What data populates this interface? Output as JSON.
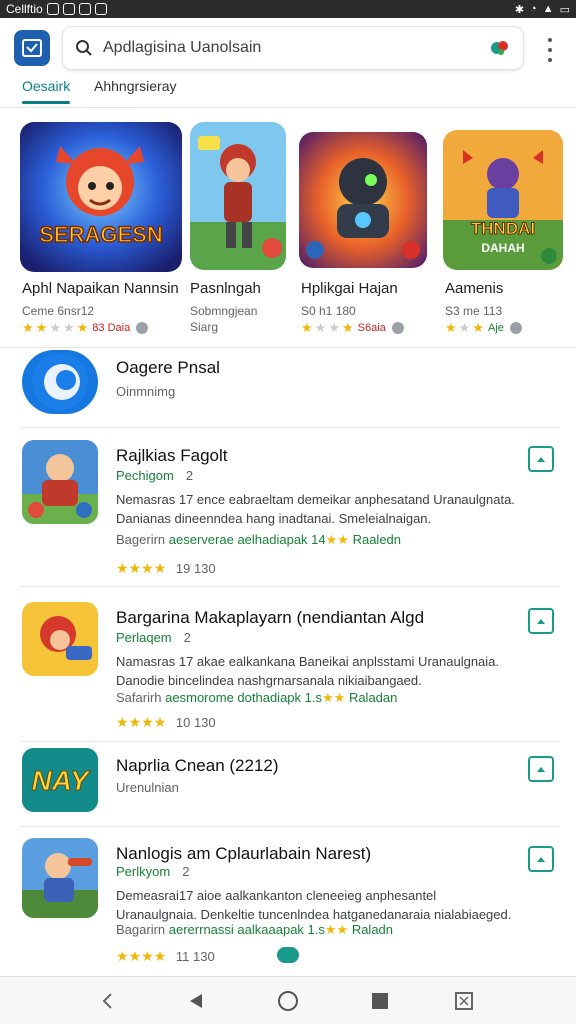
{
  "status_bar": {
    "carrier": "Cellftio"
  },
  "search": {
    "query": "Apdlagisina Uanolsain"
  },
  "tabs": [
    {
      "label": "Oesairk"
    },
    {
      "label": "Ahhngrsieray"
    }
  ],
  "featured": [
    {
      "banner": "SERAGESN",
      "name": "Aphl Napaikan Nannsin",
      "sub": "Ceme 6nsr12",
      "rating_text": "83 Daia",
      "stars": 2
    },
    {
      "name": "Pasnlngah",
      "sub": "Sobmngjean",
      "sub2": "Siarg"
    },
    {
      "name": "Hplikgai Hajan",
      "sub": "S0 h1 180",
      "rating_text": "S6aia",
      "stars": 2
    },
    {
      "banner": "THNDAI",
      "banner2": "DAHAH",
      "name": "Aamenis",
      "sub": "S3 me 113",
      "rating_text": "Aje",
      "stars": 3
    }
  ],
  "list": [
    {
      "title": "Oagere Pnsal",
      "subtitle": "Oinmnimg"
    },
    {
      "title": "Rajlkias Fagolt",
      "category": "Pechigom",
      "count": "2",
      "description": "Nemasras 17 ence eabraeltam demeikar anphesatand Uranaulgnata. Danianas dineenndea hang inadtanai. Smeleialnaigan.",
      "meta": {
        "a": "Bagerirn",
        "b": "aeserverae",
        "c": "aelhadiapak 14",
        "d": "Raaledn"
      },
      "rating": "19 130"
    },
    {
      "title": "Bargarina Makaplayarn (nendiantan Algd",
      "category": "Perlaqem",
      "count": "2",
      "description": "Namasras 17 akae ealkankana Baneikai anplsstami Uranaulgnaia. Danodie bincelindea nashgrnarsanala nikiaibangaed.",
      "meta": {
        "a": "Safarirh",
        "b": "aesmorome",
        "c": "dothadiapk 1.s",
        "d": "Raladan"
      },
      "rating": "10 130"
    },
    {
      "title": "Naprlia Cnean (2212)",
      "subtitle": "Urenulnian",
      "icon_text": "NAY"
    },
    {
      "title": "Nanlogis am Cplaurlabain Narest)",
      "category": "Perlkyom",
      "count": "2",
      "description": "Demeasrai17 aioe aalkankanton cleneeieg anphesantel Uranaulgnaia. Denkeltie tuncenlndea hatganedanaraia nialabiaeged.",
      "meta": {
        "a": "Bagarirn",
        "b": "aererrnassi",
        "c": "aalkaaapak 1.s",
        "d": "Raladn"
      },
      "rating": "11 130"
    }
  ]
}
